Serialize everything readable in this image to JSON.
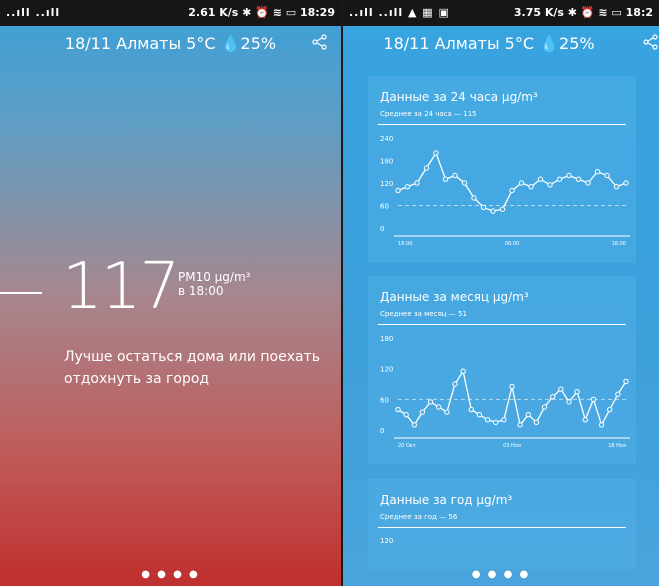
{
  "left": {
    "status": {
      "signal": "..ıll ..ıll",
      "right": "2.61 K/s  ✱ ⏰ ≋ ▭ 18:29"
    },
    "header": {
      "text": "18/11 Алматы 5°C 💧25%"
    },
    "share_icon": "share-icon",
    "pm": {
      "value": "117",
      "unit_line1": "PM10 μg/m³",
      "unit_line2": "в 18:00"
    },
    "advice": "Лучше остаться дома или поехать отдохнуть за город",
    "dots": "● ● ● ●"
  },
  "right": {
    "status": {
      "signal": "..ıll ..ıll ▲ ▦ ▣",
      "right": "3.75 K/s ✱ ⏰ ≋ ▭ 18:2"
    },
    "header": {
      "text": "18/11 Алматы 5°C 💧25%"
    },
    "share_icon": "share-icon",
    "cards": [
      {
        "title": "Данные за 24 часа μg/m³",
        "subtitle": "Среднее за 24 часа — 115",
        "yticks": [
          "240",
          "180",
          "120",
          "60",
          "0"
        ],
        "xticks": [
          "18:00",
          "06:00",
          "18:00"
        ]
      },
      {
        "title": "Данные за месяц μg/m³",
        "subtitle": "Среднее за месяц — 51",
        "yticks": [
          "180",
          "120",
          "60",
          "0"
        ],
        "xticks": [
          "20 Окт",
          "03 Ноя",
          "18 Ноя"
        ]
      },
      {
        "title": "Данные за год μg/m³",
        "subtitle": "Среднее за год — 56",
        "yticks": [
          "120"
        ],
        "xticks": []
      }
    ],
    "dots": "● ● ● ●"
  },
  "chart_data": [
    {
      "type": "line",
      "title": "Данные за 24 часа μg/m³",
      "ylim": [
        0,
        240
      ],
      "x": [
        "18:00",
        "",
        "",
        "",
        "",
        "",
        "",
        "",
        "",
        "",
        "",
        "06:00",
        "",
        "",
        "",
        "",
        "",
        "",
        "",
        "",
        "",
        "",
        "",
        "18:00"
      ],
      "series": [
        {
          "values": [
            100,
            110,
            120,
            160,
            200,
            130,
            140,
            120,
            80,
            55,
            45,
            50,
            100,
            120,
            110,
            130,
            115,
            130,
            140,
            130,
            120,
            150,
            140,
            110,
            120
          ]
        }
      ]
    },
    {
      "type": "line",
      "title": "Данные за месяц μg/m³",
      "ylim": [
        0,
        180
      ],
      "x": [
        "20 Окт",
        "03 Ноя",
        "18 Ноя"
      ],
      "series": [
        {
          "values": [
            40,
            30,
            10,
            35,
            55,
            45,
            35,
            90,
            115,
            40,
            30,
            20,
            15,
            20,
            85,
            10,
            30,
            15,
            45,
            65,
            80,
            55,
            75,
            20,
            60,
            10,
            40,
            70,
            95
          ]
        }
      ]
    }
  ]
}
